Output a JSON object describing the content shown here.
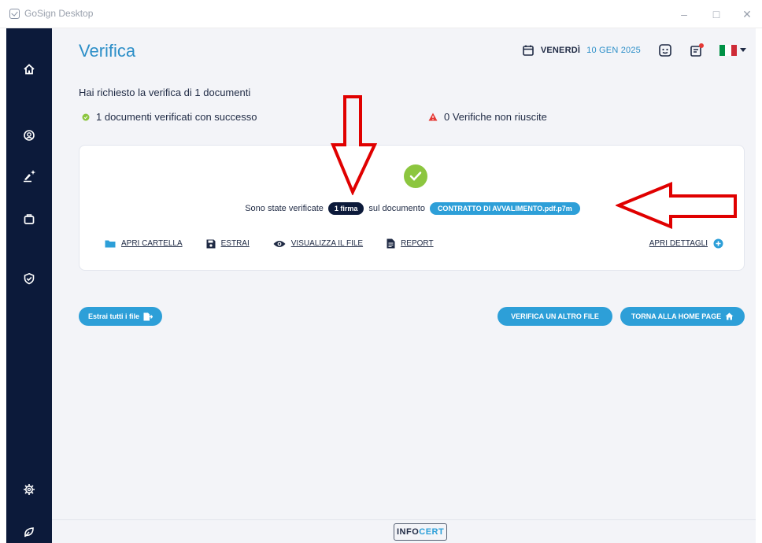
{
  "window": {
    "title": "GoSign Desktop",
    "minimize": "–",
    "maximize": "□",
    "close": "✕"
  },
  "sidebar": {
    "items": [
      {
        "name": "home-icon"
      },
      {
        "name": "user-icon"
      },
      {
        "name": "signature-icon"
      },
      {
        "name": "briefcase-icon"
      },
      {
        "name": "shield-check-icon"
      },
      {
        "name": "gear-icon"
      },
      {
        "name": "leaf-icon"
      }
    ]
  },
  "header": {
    "title": "Verifica",
    "date_day": "VENERDÌ",
    "date_rest": "10 GEN 2025",
    "flag_colors": [
      "#009246",
      "#ffffff",
      "#ce2b37"
    ]
  },
  "summary": {
    "title": "Hai richiesto la verifica di 1 documenti",
    "success": "1 documenti verificati con successo",
    "failed": "0 Verifiche non riuscite"
  },
  "result": {
    "text_before": "Sono state verificate",
    "signatures_pill": "1 firma",
    "text_middle": "sul documento",
    "document_pill": "CONTRATTO DI AVVALIMENTO.pdf.p7m",
    "actions": {
      "open_folder": "APRI CARTELLA",
      "extract": "ESTRAI",
      "view_file": "VISUALIZZA IL FILE",
      "report": "REPORT"
    },
    "open_details": "APRI DETTAGLI"
  },
  "buttons": {
    "extract_all": "Estrai tutti i file",
    "verify_another": "VERIFICA UN ALTRO FILE",
    "back_home": "TORNA ALLA HOME PAGE"
  },
  "footer": {
    "logo_left": "INFO",
    "logo_right": "CERT"
  },
  "colors": {
    "accent": "#2d9fd8",
    "navy": "#0c1a3a",
    "success": "#8cc63f",
    "warning": "#e53935",
    "annotation": "#e00000"
  }
}
